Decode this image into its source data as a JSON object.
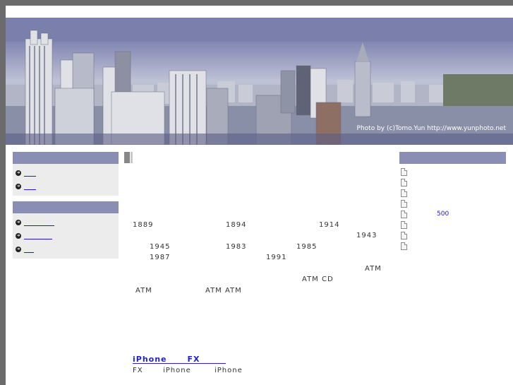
{
  "hero": {
    "credit": "Photo by (c)Tomo.Yun http://www.yunphoto.net"
  },
  "left_sidebar": {
    "boxes": [
      {
        "items": [
          {
            "icon": "arrow-circle-icon"
          },
          {
            "icon": "arrow-circle-icon"
          }
        ]
      },
      {
        "items": [
          {
            "icon": "arrow-circle-icon"
          },
          {
            "icon": "arrow-circle-icon"
          },
          {
            "icon": "arrow-circle-icon"
          }
        ]
      }
    ]
  },
  "article": {
    "year_1889": "1889",
    "year_1894": "1894",
    "year_1914": "1914",
    "year_1943": "1943",
    "year_1945": "1945",
    "year_1983": "1983",
    "year_1985": "1985",
    "year_1987": "1987",
    "year_1991": "1991",
    "atm_1": "ATM",
    "atm_cd": "ATM CD",
    "atm_2": "ATM",
    "atm_atm": "ATM ATM"
  },
  "post": {
    "title": "iPhone      FX",
    "summary_fx": "FX",
    "summary_iphone_1": "iPhone",
    "summary_iphone_2": "iPhone"
  },
  "right_sidebar": {
    "docs": [
      {
        "text": ""
      },
      {
        "text": ""
      },
      {
        "text": ""
      },
      {
        "text": ""
      },
      {
        "text": "500"
      },
      {
        "text": ""
      },
      {
        "text": ""
      },
      {
        "text": ""
      }
    ]
  }
}
